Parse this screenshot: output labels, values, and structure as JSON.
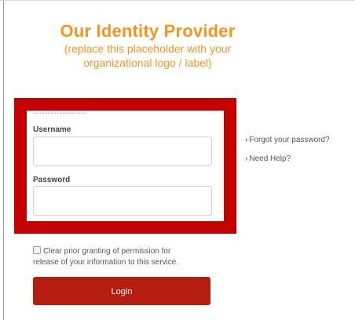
{
  "logo": {
    "title": "Our Identity Provider",
    "subtitle_line1": "(replace this placeholder with your",
    "subtitle_line2": "organizational logo / label)"
  },
  "form": {
    "username_label": "Username",
    "username_value": "",
    "password_label": "Password",
    "password_value": ""
  },
  "links": {
    "forgot_password": "Forgot your password?",
    "need_help": "Need Help?"
  },
  "consent": {
    "checked": false,
    "text": "Clear prior granting of permission for release of your information to this service."
  },
  "login_button": {
    "label": "Login"
  },
  "colors": {
    "logo_orange": "#f7941d",
    "highlight_red": "#c40000",
    "button_red": "#b51d0f"
  },
  "icons": {
    "link_bullet": "chevron-right-icon",
    "consent_checkbox": "checkbox-icon"
  }
}
